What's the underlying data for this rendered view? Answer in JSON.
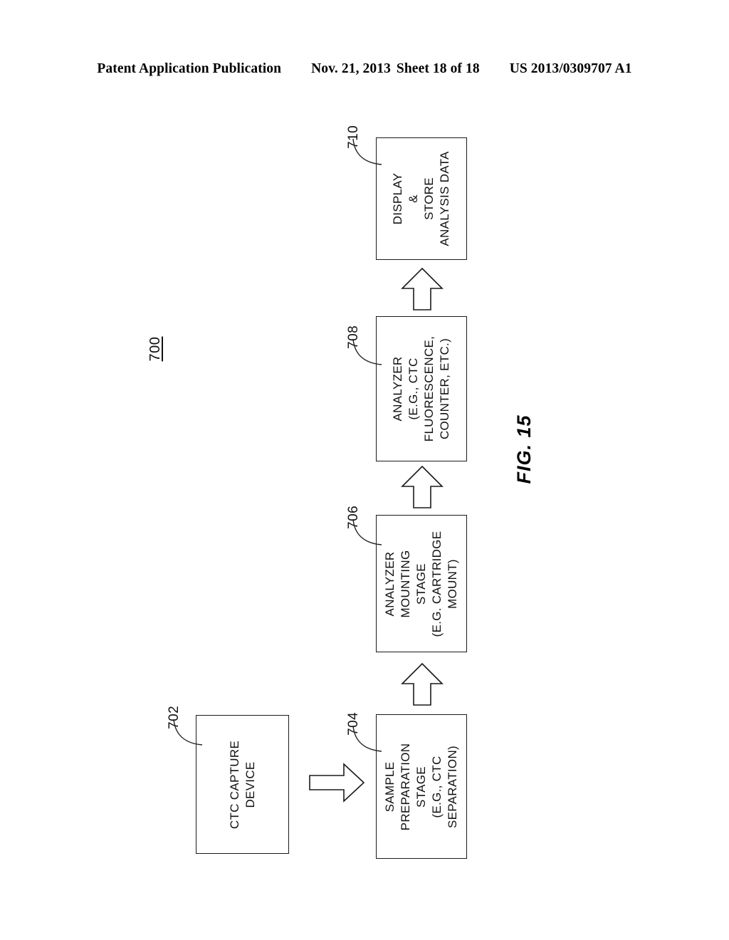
{
  "header": {
    "publication": "Patent Application Publication",
    "date": "Nov. 21, 2013",
    "sheet": "Sheet 18 of 18",
    "patent_number": "US 2013/0309707 A1"
  },
  "figure": {
    "caption": "FIG. 15",
    "system_label": "700",
    "boxes": [
      {
        "ref": "702",
        "text": "CTC CAPTURE\nDEVICE"
      },
      {
        "ref": "704",
        "text": "SAMPLE\nPREPARATION\nSTAGE\n(E.G., CTC\nSEPARATION)"
      },
      {
        "ref": "706",
        "text": "ANALYZER\nMOUNTING\nSTAGE\n(E.G. CARTRIDGE\nMOUNT)"
      },
      {
        "ref": "708",
        "text": "ANALYZER\n(E.G., CTC\nFLUORESCENCE,\nCOUNTER, ETC.)"
      },
      {
        "ref": "710",
        "text": "DISPLAY\n&\nSTORE\nANALYSIS DATA"
      }
    ],
    "arrows": [
      {
        "name": "arrow-702-704",
        "direction": "right"
      },
      {
        "name": "arrow-704-706",
        "direction": "up"
      },
      {
        "name": "arrow-706-708",
        "direction": "up"
      },
      {
        "name": "arrow-708-710",
        "direction": "up"
      }
    ]
  },
  "colors": {
    "ink": "#111111",
    "page": "#ffffff"
  }
}
